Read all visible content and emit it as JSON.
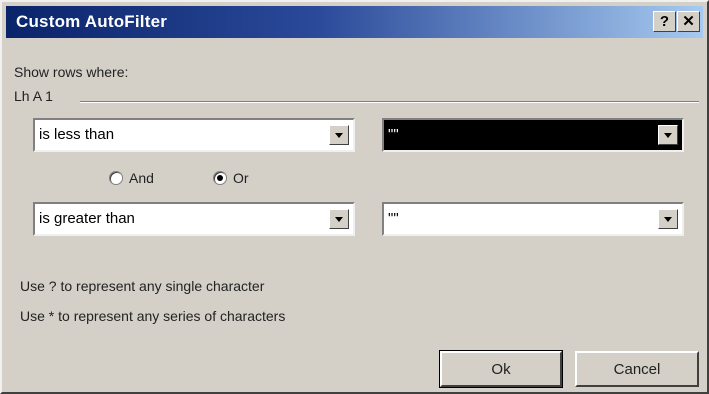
{
  "window": {
    "title": "Custom AutoFilter",
    "help_label": "?",
    "close_label": "✕"
  },
  "show_rows_label": "Show rows where:",
  "field_name": "Lh A 1",
  "criteria1": {
    "operator": "is less than",
    "value": "\"\""
  },
  "logic": {
    "and_label": "And",
    "or_label": "Or",
    "selected": "or"
  },
  "criteria2": {
    "operator": "is greater than",
    "value": "\"\""
  },
  "hints": {
    "single": "Use ? to represent any single character",
    "series": "Use * to represent any series of characters"
  },
  "buttons": {
    "ok": "Ok",
    "cancel": "Cancel"
  },
  "colors": {
    "titlebar_start": "#0a246a",
    "titlebar_end": "#a6caf0",
    "face": "#d4d0c8"
  }
}
